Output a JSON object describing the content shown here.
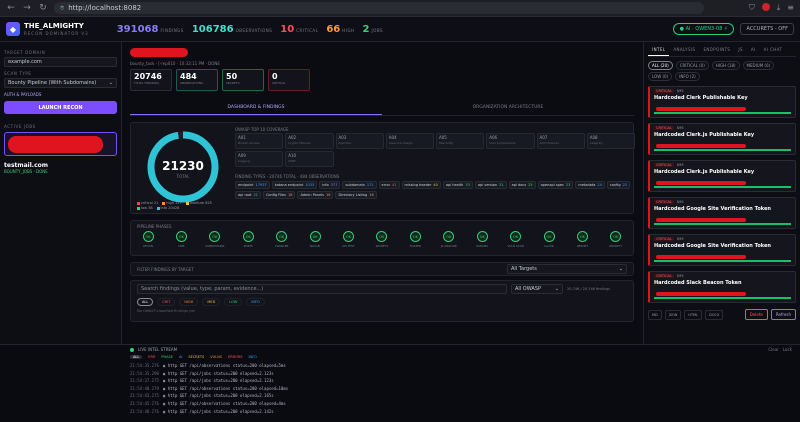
{
  "browser": {
    "url": "http://localhost:8082"
  },
  "topbar": {
    "title": "THE_ALMIGHTY",
    "subtitle": "RECON DOMINATOR V3",
    "stats": [
      {
        "value": "391068",
        "label": "FINDINGS",
        "color": "#8a7dff"
      },
      {
        "value": "106786",
        "label": "OBSERVATIONS",
        "color": "#3ee0d0"
      },
      {
        "value": "10",
        "label": "CRITICAL",
        "color": "#ff4d5e"
      },
      {
        "value": "66",
        "label": "HIGH",
        "color": "#ff9a3c"
      },
      {
        "value": "2",
        "label": "JOBS",
        "color": "#36d07a"
      }
    ],
    "ai_pill": "● AI · QWEN3-08 ⚡",
    "account_pill": "ACCURETS - OFF"
  },
  "left": {
    "target_label": "TARGET DOMAIN",
    "target_value": "example.com",
    "scan_label": "SCAN TYPE",
    "scan_value": "Bounty Pipeline (With Subdomains)",
    "auth_label": "AUTH & PAYLOADS",
    "launch": "LAUNCH RECON",
    "active_label": "ACTIVE JOBS",
    "job_domain": "testmail.com",
    "job_status": "BOUNTY_JOBS · DONE"
  },
  "main": {
    "job_meta": "bounty_task · [-rep010 · 10:32:11 PM · DONE",
    "kpis": [
      {
        "value": "20746",
        "label": "TOTAL FINDINGS",
        "color": "#2a2d36"
      },
      {
        "value": "484",
        "label": "OBSERVATIONS",
        "color": "#1d5a56"
      },
      {
        "value": "50",
        "label": "SECRETS",
        "color": "#1a6b3e"
      },
      {
        "value": "0",
        "label": "CRITICAL",
        "color": "#6b1a22"
      }
    ],
    "tabs": [
      "DASHBOARD & FINDINGS",
      "ORGANIZATION ARCHITECTURE"
    ],
    "donut": {
      "value": "21230",
      "label": "TOTAL"
    },
    "legend": [
      {
        "label": "critical 21",
        "color": "#ff3b4e"
      },
      {
        "label": "high 127",
        "color": "#ff8a3c"
      },
      {
        "label": "medium 625",
        "color": "#e6c23a"
      },
      {
        "label": "low 38",
        "color": "#31d07a"
      },
      {
        "label": "info 20428",
        "color": "#2ec4d6"
      }
    ],
    "owasp_title": "OWASP TOP 10 COVERAGE",
    "owasp": [
      {
        "code": "A01",
        "name": "Broken Access"
      },
      {
        "code": "A02",
        "name": "Crypto Failures"
      },
      {
        "code": "A03",
        "name": "Injection"
      },
      {
        "code": "A04",
        "name": "Insecure Design"
      },
      {
        "code": "A05",
        "name": "Misconfig"
      },
      {
        "code": "A06",
        "name": "Vuln Components"
      },
      {
        "code": "A07",
        "name": "Auth Failures"
      },
      {
        "code": "A08",
        "name": "Integrity"
      },
      {
        "code": "A09",
        "name": "Logging"
      },
      {
        "code": "A10",
        "name": "SSRF"
      }
    ],
    "types_title": "FINDING TYPES · 20746 TOTAL · 484 OBSERVATIONS",
    "types": [
      {
        "name": "endpoint",
        "count": "17937",
        "color": "#3aa0ff"
      },
      {
        "name": "katana endpoint",
        "count": "1033",
        "color": "#3aa0ff"
      },
      {
        "name": "info",
        "count": "377",
        "color": "#8a7dff"
      },
      {
        "name": "subdomain",
        "count": "171",
        "color": "#3aa0ff"
      },
      {
        "name": "error",
        "count": "41",
        "color": "#ff4d5e"
      },
      {
        "name": "missing header",
        "count": "40",
        "color": "#e6c23a"
      },
      {
        "name": "api health",
        "count": "33",
        "color": "#31d07a"
      },
      {
        "name": "api version",
        "count": "31",
        "color": "#31d07a"
      },
      {
        "name": "api docs",
        "count": "25",
        "color": "#31d07a"
      },
      {
        "name": "openapi spec",
        "count": "23",
        "color": "#31d07a"
      },
      {
        "name": "metadata",
        "count": "24",
        "color": "#3aa0ff"
      },
      {
        "name": "config",
        "count": "22",
        "color": "#3aa0ff"
      },
      {
        "name": "api root",
        "count": "21",
        "color": "#31d07a"
      },
      {
        "name": "Config Files",
        "count": "18",
        "color": "#ff8a3c"
      },
      {
        "name": "Admin Panels",
        "count": "16",
        "color": "#ff8a3c"
      },
      {
        "name": "Directory Listing",
        "count": "16",
        "color": "#ff8a3c"
      }
    ],
    "pipeline_title": "PIPELINE PHASES",
    "phases": [
      "RECON",
      "DNS",
      "SUBDOMAINS",
      "PORTS",
      "CRAWLER",
      "NUCLEI",
      "API TEST",
      "SECRETS",
      "FUZZER",
      "JS ANALYZE",
      "PARAMS",
      "VULN SCAN",
      "CLOUD",
      "REPORT",
      "PRIORITY"
    ],
    "phase_status": "OK",
    "filter_label": "FILTER FINDINGS BY TARGET",
    "filter_value": "All Targets",
    "search_placeholder": "Search findings (value, type, param, evidence...)",
    "owasp_select": "All OWASP",
    "count_text": "20,746 / 20,746 findings",
    "sev_chips": [
      "ALL",
      "CRIT",
      "HIGH",
      "MED",
      "LOW",
      "INFO"
    ],
    "sev_colors": [
      "#ffffff",
      "#ff4d5e",
      "#ff8a3c",
      "#e6c23a",
      "#31d07a",
      "#3aa0ff"
    ],
    "owasp_note": "No OWASP-classified findings yet"
  },
  "right": {
    "tabs": [
      "INTEL",
      "ANALYSIS",
      "ENDPOINTS",
      "JS",
      "AI",
      "AI CHAT"
    ],
    "chips1": [
      "ALL (20)",
      "CRITICAL (0)",
      "HIGH (18)",
      "MEDIUM (0)"
    ],
    "chips2": [
      "LOW (0)",
      "INFO (2)"
    ],
    "cards": [
      {
        "severity": "CRITICAL",
        "score": "$95",
        "title": "Hardcoded Clerk Publishable Key"
      },
      {
        "severity": "CRITICAL",
        "score": "$95",
        "title": "Hardcoded Clerk.js Publishable Key"
      },
      {
        "severity": "CRITICAL",
        "score": "$95",
        "title": "Hardcoded Clerk.js Publishable Key"
      },
      {
        "severity": "CRITICAL",
        "score": "$95",
        "title": "Hardcoded Google Site Verification Token"
      },
      {
        "severity": "CRITICAL",
        "score": "$95",
        "title": "Hardcoded Google Site Verification Token"
      },
      {
        "severity": "CRITICAL",
        "score": "$95",
        "title": "Hardcoded Slack Beacon Token"
      }
    ],
    "footer_buttons": [
      "MD",
      "JSON",
      "HTML",
      "DOCX"
    ],
    "delete": "Delete",
    "refresh": "Refresh"
  },
  "stream": {
    "title": "LIVE INTEL STREAM",
    "filters": [
      "ALL",
      "ERR",
      "PHASE",
      "AI",
      "SECRETS",
      "VULNS",
      "ERRORS",
      "INFO"
    ],
    "clear": "Clear",
    "lock": "Lock",
    "lines": [
      {
        "ts": "21:54:35.276",
        "text": "◉ http GET /api/observations status=200 elapsed=5ms"
      },
      {
        "ts": "21:54:35.290",
        "text": "◉ http GET /api/jobs status=200 elapsed=2.123s"
      },
      {
        "ts": "21:54:37.275",
        "text": "◉ http GET /api/jobs status=200 elapsed=2.123s"
      },
      {
        "ts": "21:54:40.279",
        "text": "◉ http GET /api/observations status=200 elapsed=10ms"
      },
      {
        "ts": "21:54:43.275",
        "text": "◉ http GET /api/jobs status=200 elapsed=2.165s"
      },
      {
        "ts": "21:54:45.276",
        "text": "◉ http GET /api/observations status=200 elapsed=4ms"
      },
      {
        "ts": "21:54:48.276",
        "text": "◉ http GET /api/jobs status=200 elapsed=2.142s"
      }
    ]
  }
}
